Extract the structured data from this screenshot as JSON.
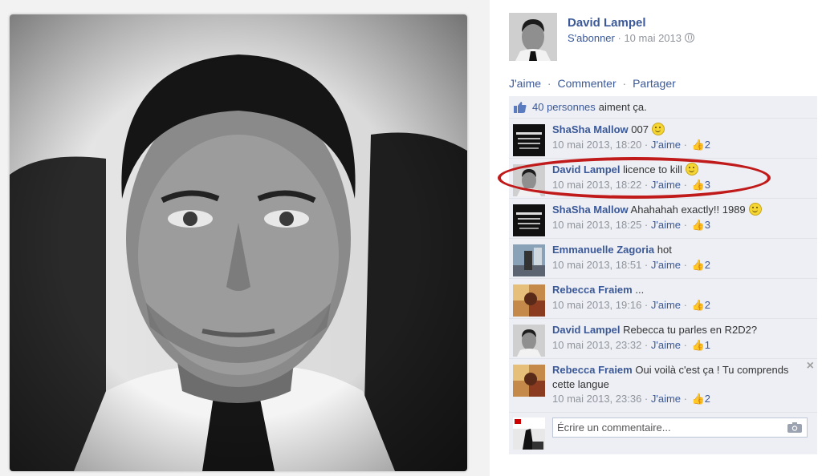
{
  "post": {
    "author": "David Lampel",
    "subscribe": "S'abonner",
    "meta_sep": " · ",
    "date": "10 mai 2013",
    "privacy_icon": "globe-icon"
  },
  "actions": {
    "like": "J'aime",
    "comment": "Commenter",
    "share": "Partager",
    "sep": "·"
  },
  "likes": {
    "count_link": "40 personnes",
    "text": "aiment ça."
  },
  "comments": [
    {
      "author": "ShaSha Mallow",
      "text": "007",
      "emoji": true,
      "time": "10 mai 2013, 18:20",
      "like": "J'aime",
      "likes": "2",
      "avatar": "poster"
    },
    {
      "author": "David Lampel",
      "text": "licence to kill",
      "emoji": true,
      "time": "10 mai 2013, 18:22",
      "like": "J'aime",
      "likes": "3",
      "avatar": "portrait"
    },
    {
      "author": "ShaSha Mallow",
      "text": "Ahahahah exactly!! 1989",
      "emoji": true,
      "time": "10 mai 2013, 18:25",
      "like": "J'aime",
      "likes": "3",
      "avatar": "poster"
    },
    {
      "author": "Emmanuelle Zagoria",
      "text": "hot",
      "emoji": false,
      "time": "10 mai 2013, 18:51",
      "like": "J'aime",
      "likes": "2",
      "avatar": "street"
    },
    {
      "author": "Rebecca Fraiem",
      "text": "...",
      "emoji": false,
      "time": "10 mai 2013, 19:16",
      "like": "J'aime",
      "likes": "2",
      "avatar": "colorful"
    },
    {
      "author": "David Lampel",
      "text": "Rebecca tu parles en R2D2?",
      "emoji": false,
      "time": "10 mai 2013, 23:32",
      "like": "J'aime",
      "likes": "1",
      "avatar": "portrait"
    },
    {
      "author": "Rebecca Fraiem",
      "text": "Oui voilà c'est ça ! Tu comprends cette langue",
      "emoji": false,
      "time": "10 mai 2013, 23:36",
      "like": "J'aime",
      "likes": "2",
      "avatar": "colorful"
    }
  ],
  "composer": {
    "placeholder": "Écrire un commentaire...",
    "camera_icon": "camera-icon"
  },
  "colors": {
    "link": "#3b5998",
    "highlight": "#c01a1a",
    "comment_bg": "#edeff4"
  }
}
